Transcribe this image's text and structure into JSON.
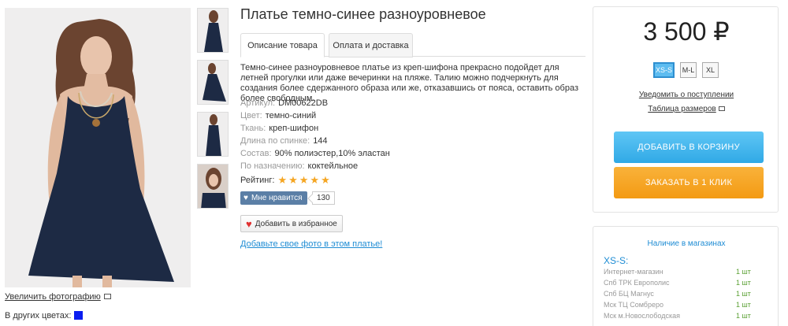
{
  "product": {
    "title": "Платье темно-синее разноуровневое",
    "description": "Темно-синее разноуровневое платье из креп-шифона прекрасно подойдет для летней прогулки или даже вечеринки на пляже. Талию можно подчеркнуть для создания более сдержанного образа или же, отказавшись от пояса, оставить образ более свободным.",
    "props": [
      {
        "key": "Артикул:",
        "value": "DM00622DB"
      },
      {
        "key": "Цвет:",
        "value": "темно-синий"
      },
      {
        "key": "Ткань:",
        "value": "креп-шифон"
      },
      {
        "key": "Длина по спинке:",
        "value": "144"
      },
      {
        "key": "Состав:",
        "value": "90% полиэстер,10% эластан"
      },
      {
        "key": "По назначению:",
        "value": "коктейльное"
      }
    ],
    "rating_label": "Рейтинг:",
    "rating_stars": "★★★★★",
    "rating_value": 5,
    "like_label": "Мне нравится",
    "like_count": "130",
    "fav_label": "Добавить в избранное",
    "add_photo_link": "Добавьте свое фото в этом платье!"
  },
  "tabs": [
    {
      "label": "Описание товара",
      "active": true
    },
    {
      "label": "Оплата и доставка",
      "active": false
    }
  ],
  "gallery": {
    "enlarge_label": "Увеличить фотографию",
    "other_colors_label": "В других цветах:",
    "other_color": "#0b1ef0",
    "dress_color": "#1d2a44"
  },
  "buy": {
    "price": "3 500",
    "currency": "₽",
    "sizes": [
      {
        "label": "XS-S",
        "active": true
      },
      {
        "label": "M-L",
        "active": false
      },
      {
        "label": "XL",
        "active": false
      }
    ],
    "notify_label": "Уведомить о поступлении",
    "size_table_label": "Таблица размеров",
    "cart_button": "ДОБАВИТЬ В КОРЗИНУ",
    "one_click_button": "ЗАКАЗАТЬ В 1 КЛИК",
    "accent_blue": "#30a9e6",
    "accent_orange": "#f39a13"
  },
  "stock": {
    "title": "Наличие в магазинах",
    "size": "XS-S:",
    "rows": [
      {
        "store": "Интернет-магазин",
        "qty": "1 шт"
      },
      {
        "store": "Спб ТРК Европолис",
        "qty": "1 шт"
      },
      {
        "store": "Спб БЦ Магнус",
        "qty": "1 шт"
      },
      {
        "store": "Мск ТЦ Сомбреро",
        "qty": "1 шт"
      },
      {
        "store": "Мск м.Новослободская",
        "qty": "1 шт"
      }
    ]
  }
}
